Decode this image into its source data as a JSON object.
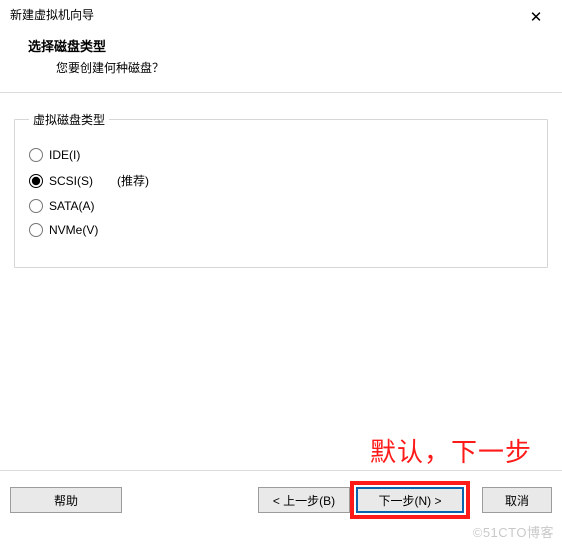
{
  "window": {
    "title": "新建虚拟机向导",
    "close_symbol": "✕"
  },
  "header": {
    "heading": "选择磁盘类型",
    "sub": "您要创建何种磁盘？"
  },
  "group": {
    "legend": "虚拟磁盘类型",
    "options": [
      {
        "id": "ide",
        "label": "IDE(I)",
        "hint": "",
        "checked": false
      },
      {
        "id": "scsi",
        "label": "SCSI(S)",
        "hint": "(推荐)",
        "checked": true
      },
      {
        "id": "sata",
        "label": "SATA(A)",
        "hint": "",
        "checked": false
      },
      {
        "id": "nvme",
        "label": "NVMe(V)",
        "hint": "",
        "checked": false
      }
    ]
  },
  "annotation": {
    "text": "默认，下一步"
  },
  "buttons": {
    "help": "帮助",
    "back": "< 上一步(B)",
    "next": "下一步(N) >",
    "cancel": "取消"
  },
  "watermark": "©51CTO博客"
}
